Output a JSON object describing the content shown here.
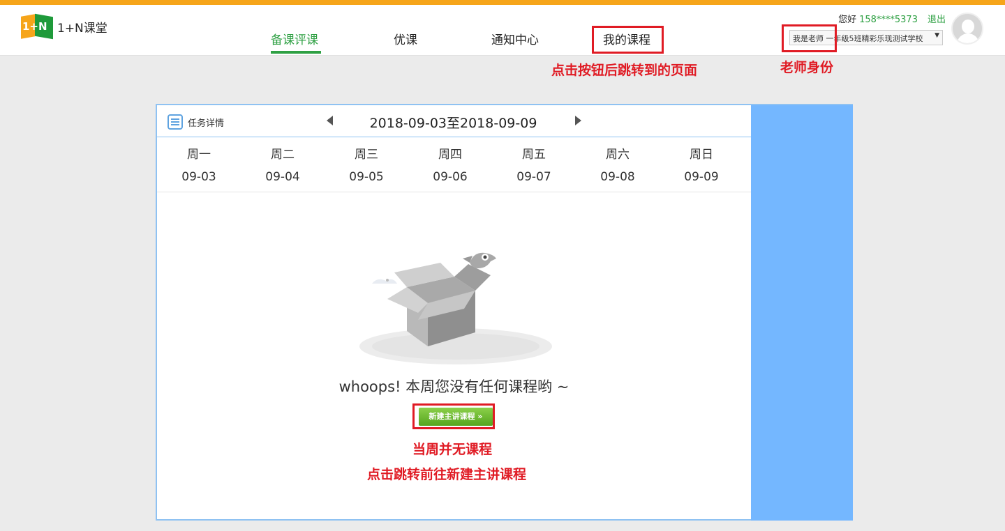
{
  "header": {
    "logo_text": "1+N课堂",
    "logo_mark": "1+N",
    "nav": [
      {
        "label": "备课评课",
        "active": true
      },
      {
        "label": "优课",
        "active": false
      },
      {
        "label": "通知中心",
        "active": false
      },
      {
        "label": "我的课程",
        "active": false
      }
    ],
    "greeting": "您好",
    "phone": "158****5373",
    "logout": "退出",
    "identity_select": "我是老师 一年级5班精彩乐现测试学校"
  },
  "annotations": {
    "nav_note": "点击按钮后跳转到的页面",
    "identity_note": "老师身份",
    "empty_note_1": "当周并无课程",
    "empty_note_2": "点击跳转前往新建主讲课程"
  },
  "schedule": {
    "task_detail": "任务详情",
    "week_range": "2018-09-03至2018-09-09",
    "days": [
      {
        "name": "周一",
        "date": "09-03"
      },
      {
        "name": "周二",
        "date": "09-04"
      },
      {
        "name": "周三",
        "date": "09-05"
      },
      {
        "name": "周四",
        "date": "09-06"
      },
      {
        "name": "周五",
        "date": "09-07"
      },
      {
        "name": "周六",
        "date": "09-08"
      },
      {
        "name": "周日",
        "date": "09-09"
      }
    ],
    "empty_message": "whoops! 本周您没有任何课程哟 ~",
    "create_button": "新建主讲课程 »"
  },
  "colors": {
    "accent_orange": "#f6a51a",
    "nav_active_green": "#2ea043",
    "annotation_red": "#e01b24",
    "panel_side_blue": "#74b7ff"
  }
}
